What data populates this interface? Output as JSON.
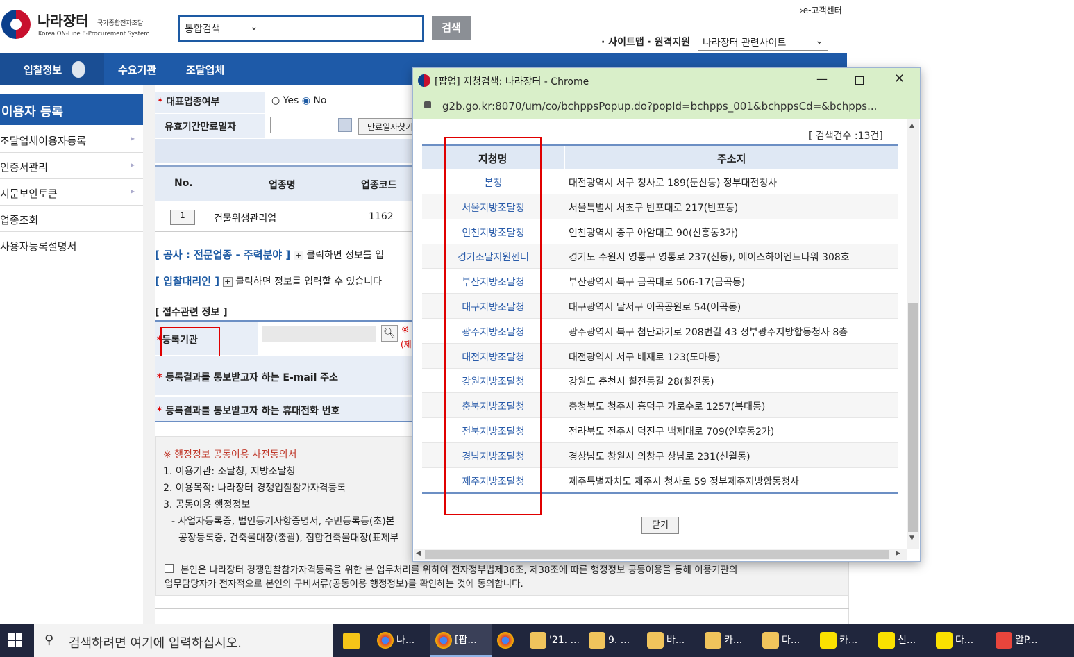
{
  "header": {
    "logo_title": "나라장터",
    "logo_sub": "국가종합전자조달",
    "logo_en": "Korea ON-Line E-Procurement System",
    "search_select": "통합검색",
    "search_button": "검색",
    "ecustomer": "›e-고객센터",
    "sitemap": "· 사이트맵 · 원격지원",
    "related_sites": "나라장터 관련사이트"
  },
  "nav": {
    "bid": "입찰정보",
    "demand": "수요기관",
    "supplier": "조달업체"
  },
  "sidebar": {
    "title": "이용자 등록",
    "items": [
      "조달업체이용자등록",
      "인증서관리",
      "지문보안토큰",
      "업종조회",
      "사용자등록설명서"
    ]
  },
  "form": {
    "rep_label": "대표업종여부",
    "yes": "Yes",
    "no": "No",
    "expire_label": "유효기간만료일자",
    "expire_btn": "만료일자찾기",
    "col_no": "No.",
    "col_name": "업종명",
    "col_code": "업종코드",
    "row_no": "1",
    "row_name": "건물위생관리업",
    "row_code": "1162",
    "construction_link": "[ 공사 : 전문업종 - 주력분야 ]",
    "construction_desc": "클릭하면 정보를 입",
    "agent_link": "[ 입찰대리인 ]",
    "agent_desc": "클릭하면 정보를 입력할 수 있습니다",
    "receipt_title": "[ 접수관련 정보 ]",
    "reg_org_label": "등록기관",
    "reg_note1": "※",
    "reg_note2": "(제",
    "email_label": "등록결과를 통보받고자 하는 E-mail 주소",
    "phone_label": "등록결과를 통보받고자 하는 휴대전화 번호",
    "consent_title": "※ 행정정보 공동이용 사전동의서",
    "consent_1": "1. 이용기관: 조달청, 지방조달청",
    "consent_2": "2. 이용목적: 나라장터 경쟁입찰참가자격등록",
    "consent_3": "3. 공동이용 행정정보",
    "consent_3a": "- 사업자등록증, 법인등기사항증명서, 주민등록등(초)본",
    "consent_3b": "공장등록증, 건축물대장(총괄), 집합건축물대장(표제부",
    "agree_1": "본인은 나라장터 경쟁입찰참가자격등록을 위한 본 업무처리를 위하여 전자정부법제36조, 제38조에 따른 행정정보 공동이용을 통해 이용기관의",
    "agree_2": "업무담당자가 전자적으로 본인의 구비서류(공동이용 행정정보)를 확인하는 것에 동의합니다."
  },
  "popup": {
    "window_title": "[팝업] 지청검색: 나라장터 - Chrome",
    "url": "g2b.go.kr:8070/um/co/bchppsPopup.do?popId=bchpps_001&bchppsCd=&bchpps...",
    "count": "[  검색건수 :13건]",
    "col_name": "지청명",
    "col_addr": "주소지",
    "rows": [
      {
        "name": "본청",
        "addr": "대전광역시 서구 청사로 189(둔산동) 정부대전청사"
      },
      {
        "name": "서울지방조달청",
        "addr": "서울특별시 서초구 반포대로 217(반포동)"
      },
      {
        "name": "인천지방조달청",
        "addr": "인천광역시 중구 아암대로 90(신흥동3가)"
      },
      {
        "name": "경기조달지원센터",
        "addr": "경기도 수원시 영통구 영통로 237(신동), 에이스하이엔드타워 308호"
      },
      {
        "name": "부산지방조달청",
        "addr": "부산광역시 북구 금곡대로 506-17(금곡동)"
      },
      {
        "name": "대구지방조달청",
        "addr": "대구광역시 달서구 이곡공원로 54(이곡동)"
      },
      {
        "name": "광주지방조달청",
        "addr": "광주광역시 북구 첨단과기로 208번길 43 정부광주지방합동청사 8층"
      },
      {
        "name": "대전지방조달청",
        "addr": "대전광역시 서구 배재로 123(도마동)"
      },
      {
        "name": "강원지방조달청",
        "addr": "강원도 춘천시 칠전동길 28(칠전동)"
      },
      {
        "name": "충북지방조달청",
        "addr": "충청북도 청주시 흥덕구 가로수로 1257(복대동)"
      },
      {
        "name": "전북지방조달청",
        "addr": "전라북도 전주시 덕진구 백제대로 709(인후동2가)"
      },
      {
        "name": "경남지방조달청",
        "addr": "경상남도 창원시 의창구 상남로 231(신월동)"
      },
      {
        "name": "제주지방조달청",
        "addr": "제주특별자치도 제주시 청사로 59 정부제주지방합동청사"
      }
    ],
    "close_btn": "닫기"
  },
  "taskbar": {
    "search": "검색하려면 여기에 입력하십시오.",
    "items": [
      "나...",
      "[팝...",
      "",
      "'21. ...",
      "9. ...",
      "바...",
      "카...",
      "다...",
      "카...",
      "신...",
      "다...",
      "알P..."
    ]
  }
}
